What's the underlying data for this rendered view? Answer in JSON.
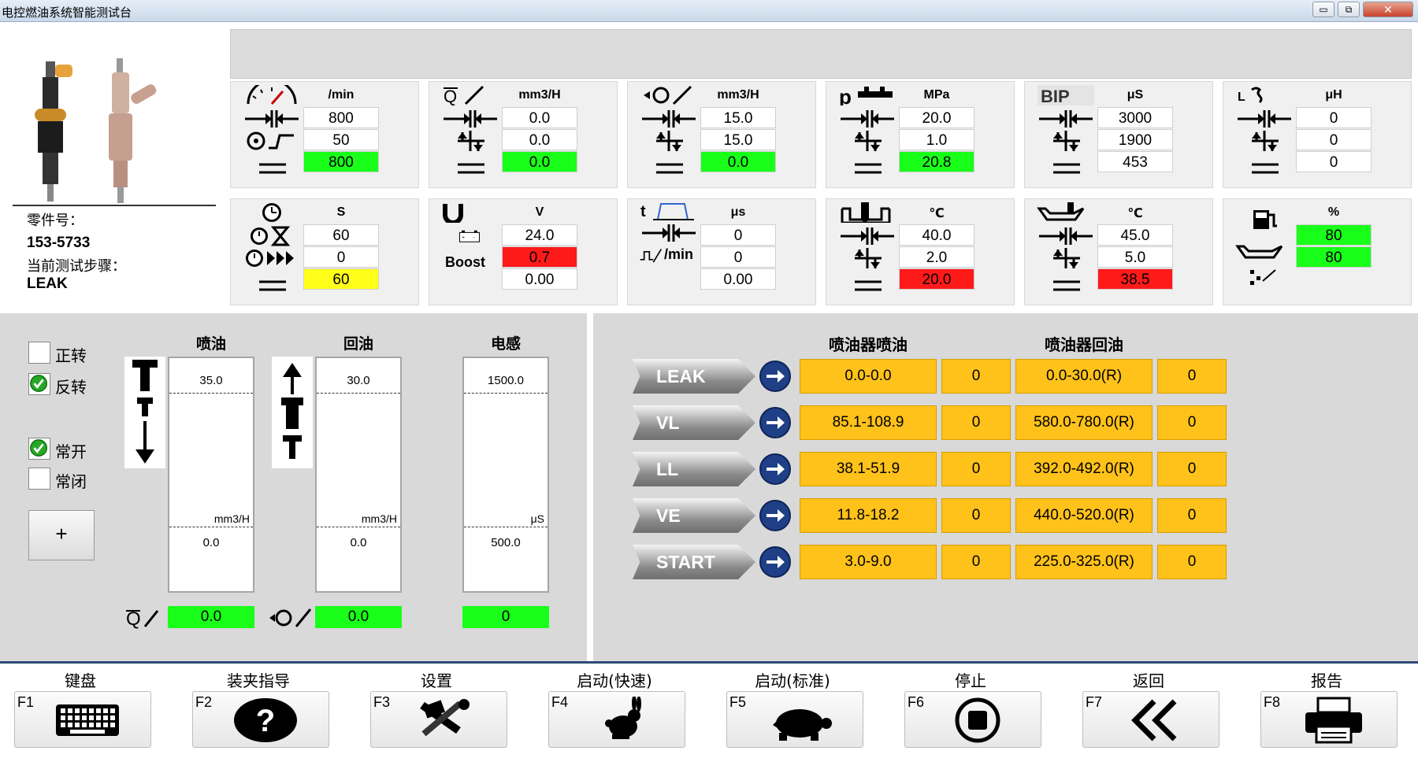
{
  "window": {
    "title": "电控燃油系统智能测试台",
    "min": "▭",
    "max": "⧉",
    "close": "✕"
  },
  "part": {
    "part_no_label": "零件号：",
    "part_no": "153-5733",
    "step_label": "当前测试步骤：",
    "step": "LEAK"
  },
  "panels": [
    {
      "unit": "/min",
      "values": [
        "800",
        "50",
        "800"
      ],
      "status": [
        "",
        "",
        "green"
      ],
      "icons": [
        "tachometer-icon",
        "compress-arrows-icon",
        "speed-ramp-icon",
        "equals-icon"
      ]
    },
    {
      "unit": "mm3/H",
      "values": [
        "0.0",
        "0.0",
        "0.0"
      ],
      "status": [
        "",
        "",
        "green"
      ],
      "icons": [
        "injection-flow-icon",
        "compress-arrows-icon",
        "tolerance-arrows-icon",
        "equals-icon"
      ]
    },
    {
      "unit": "mm3/H",
      "values": [
        "15.0",
        "15.0",
        "0.0"
      ],
      "status": [
        "",
        "",
        "green"
      ],
      "icons": [
        "return-flow-icon",
        "compress-arrows-icon",
        "tolerance-arrows-icon",
        "equals-icon"
      ]
    },
    {
      "unit": "MPa",
      "values": [
        "20.0",
        "1.0",
        "20.8"
      ],
      "status": [
        "",
        "",
        "green"
      ],
      "icons": [
        "rail-pressure-icon",
        "compress-arrows-icon",
        "tolerance-arrows-icon",
        "equals-icon"
      ]
    },
    {
      "unit": "μS",
      "values": [
        "3000",
        "1900",
        "453"
      ],
      "status": [
        "",
        "",
        ""
      ],
      "icons": [
        "bip-icon",
        "compress-arrows-icon",
        "tolerance-arrows-icon",
        "equals-icon"
      ],
      "icon_text": "BIP"
    },
    {
      "unit": "μH",
      "values": [
        "0",
        "0",
        "0"
      ],
      "status": [
        "",
        "",
        ""
      ],
      "icons": [
        "inductance-icon",
        "compress-arrows-icon",
        "tolerance-arrows-icon",
        "equals-icon"
      ]
    },
    {
      "unit": "S",
      "values": [
        "60",
        "0",
        "60"
      ],
      "status": [
        "",
        "",
        "yellow"
      ],
      "icons": [
        "clock-icon",
        "clock-hourglass-icon",
        "clock-forward-icon",
        "equals-icon"
      ]
    },
    {
      "unit": "V",
      "values": [
        "24.0",
        "0.7",
        "0.00"
      ],
      "status": [
        "",
        "red",
        ""
      ],
      "icons": [
        "voltage-icon",
        "battery-icon"
      ],
      "icon_text": "Boost"
    },
    {
      "unit": "μs",
      "values": [
        "0",
        "0",
        "0.00"
      ],
      "status": [
        "",
        "",
        ""
      ],
      "icons": [
        "pulse-time-icon",
        "compress-arrows-icon",
        "pulse-per-min-icon"
      ],
      "icon_text": "/min"
    },
    {
      "unit": "℃",
      "values": [
        "40.0",
        "2.0",
        "20.0"
      ],
      "status": [
        "",
        "",
        "red"
      ],
      "icons": [
        "tank-temperature-icon",
        "compress-arrows-icon",
        "tolerance-arrows-icon",
        "equals-icon"
      ]
    },
    {
      "unit": "℃",
      "values": [
        "45.0",
        "5.0",
        "38.5"
      ],
      "status": [
        "",
        "",
        "red"
      ],
      "icons": [
        "oil-temperature-icon",
        "compress-arrows-icon",
        "tolerance-arrows-icon",
        "equals-icon"
      ]
    },
    {
      "unit": "%",
      "values": [
        "80",
        "80"
      ],
      "status": [
        "green",
        "green"
      ],
      "icons": [
        "fuel-level-icon",
        "oil-level-icon",
        "spray-icon"
      ]
    }
  ],
  "checks": [
    {
      "label": "正转",
      "checked": false
    },
    {
      "label": "反转",
      "checked": true
    },
    {
      "label": "常开",
      "checked": true
    },
    {
      "label": "常闭",
      "checked": false
    }
  ],
  "plus": "+",
  "gauges": [
    {
      "title": "喷油",
      "top": "35.0",
      "unit": "mm3/H",
      "bottom": "0.0",
      "reading": "0.0"
    },
    {
      "title": "回油",
      "top": "30.0",
      "unit": "mm3/H",
      "bottom": "0.0",
      "reading": "0.0"
    },
    {
      "title": "电感",
      "top": "1500.0",
      "unit": "μS",
      "bottom": "500.0",
      "reading": "0"
    }
  ],
  "table": {
    "col1": "喷油器喷油",
    "col2": "喷油器回油",
    "rows": [
      {
        "name": "LEAK",
        "spray": "0.0-0.0",
        "spray_val": "0",
        "ret": "0.0-30.0(R)",
        "ret_val": "0"
      },
      {
        "name": "VL",
        "spray": "85.1-108.9",
        "spray_val": "0",
        "ret": "580.0-780.0(R)",
        "ret_val": "0"
      },
      {
        "name": "LL",
        "spray": "38.1-51.9",
        "spray_val": "0",
        "ret": "392.0-492.0(R)",
        "ret_val": "0"
      },
      {
        "name": "VE",
        "spray": "11.8-18.2",
        "spray_val": "0",
        "ret": "440.0-520.0(R)",
        "ret_val": "0"
      },
      {
        "name": "START",
        "spray": "3.0-9.0",
        "spray_val": "0",
        "ret": "225.0-325.0(R)",
        "ret_val": "0"
      }
    ]
  },
  "fkeys": [
    {
      "key": "F1",
      "label": "键盘",
      "icon": "keyboard-icon"
    },
    {
      "key": "F2",
      "label": "装夹指导",
      "icon": "help-icon"
    },
    {
      "key": "F3",
      "label": "设置",
      "icon": "tools-icon"
    },
    {
      "key": "F4",
      "label": "启动(快速)",
      "icon": "rabbit-icon"
    },
    {
      "key": "F5",
      "label": "启动(标准)",
      "icon": "turtle-icon"
    },
    {
      "key": "F6",
      "label": "停止",
      "icon": "stop-icon"
    },
    {
      "key": "F7",
      "label": "返回",
      "icon": "back-icon"
    },
    {
      "key": "F8",
      "label": "报告",
      "icon": "printer-icon"
    }
  ],
  "colors": {
    "green": "#19ff19",
    "red": "#ff1a1a",
    "yellow": "#ffff19",
    "cell": "#ffc21a",
    "arrow": "#1f3f86"
  }
}
